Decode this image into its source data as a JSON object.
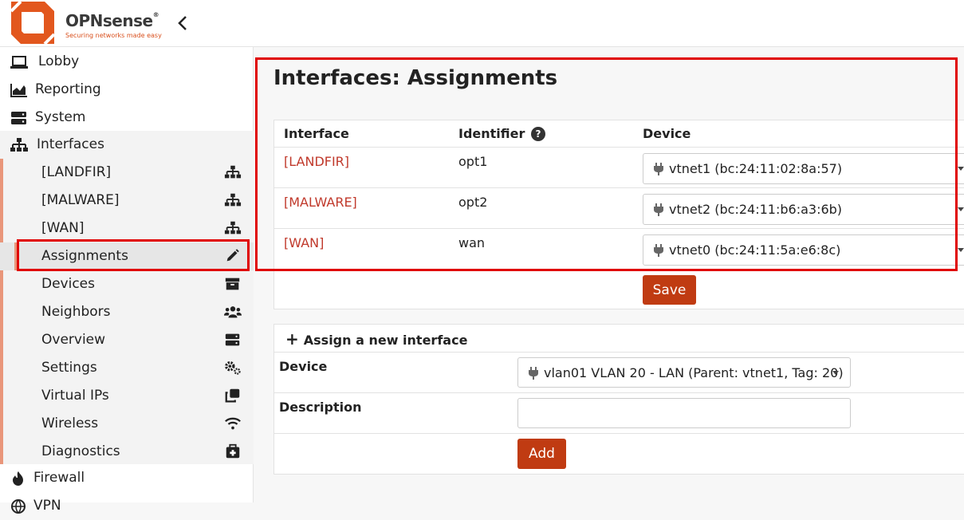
{
  "header": {
    "brand": "OPNsense",
    "brand_mark": "®",
    "tagline": "Securing networks made easy"
  },
  "sidebar": {
    "top_items": [
      {
        "label": "Lobby",
        "icon": "laptop-icon"
      },
      {
        "label": "Reporting",
        "icon": "area-chart-icon"
      },
      {
        "label": "System",
        "icon": "server-icon"
      },
      {
        "label": "Interfaces",
        "icon": "sitemap-icon"
      }
    ],
    "sub_items": [
      {
        "label": "[LANDFIR]",
        "icon": "sitemap-icon"
      },
      {
        "label": "[MALWARE]",
        "icon": "sitemap-icon"
      },
      {
        "label": "[WAN]",
        "icon": "sitemap-icon"
      },
      {
        "label": "Assignments",
        "icon": "pencil-icon"
      },
      {
        "label": "Devices",
        "icon": "archive-icon"
      },
      {
        "label": "Neighbors",
        "icon": "users-icon"
      },
      {
        "label": "Overview",
        "icon": "server-icon"
      },
      {
        "label": "Settings",
        "icon": "cogs-icon"
      },
      {
        "label": "Virtual IPs",
        "icon": "clone-icon"
      },
      {
        "label": "Wireless",
        "icon": "wifi-icon"
      },
      {
        "label": "Diagnostics",
        "icon": "medkit-icon"
      }
    ],
    "bottom_items": [
      {
        "label": "Firewall",
        "icon": "fire-icon"
      },
      {
        "label": "VPN",
        "icon": "globe-icon"
      }
    ]
  },
  "page": {
    "title": "Interfaces: Assignments"
  },
  "table": {
    "columns": [
      "Interface",
      "Identifier",
      "Device"
    ],
    "help": "?",
    "rows": [
      {
        "interface": "[LANDFIR]",
        "identifier": "opt1",
        "device": "vtnet1 (bc:24:11:02:8a:57)"
      },
      {
        "interface": "[MALWARE]",
        "identifier": "opt2",
        "device": "vtnet2 (bc:24:11:b6:a3:6b)"
      },
      {
        "interface": "[WAN]",
        "identifier": "wan",
        "device": "vtnet0 (bc:24:11:5a:e6:8c)"
      }
    ],
    "save_label": "Save"
  },
  "assign": {
    "heading": "Assign a new interface",
    "plus": "+",
    "device_label": "Device",
    "device_value": "vlan01 VLAN 20 - LAN (Parent: vtnet1, Tag: 20)",
    "description_label": "Description",
    "description_value": "",
    "add_label": "Add"
  },
  "colors": {
    "accent": "#c03b12",
    "link": "#c0392b",
    "highlight_box": "#e00000",
    "submenu_bar": "#e9967a"
  }
}
